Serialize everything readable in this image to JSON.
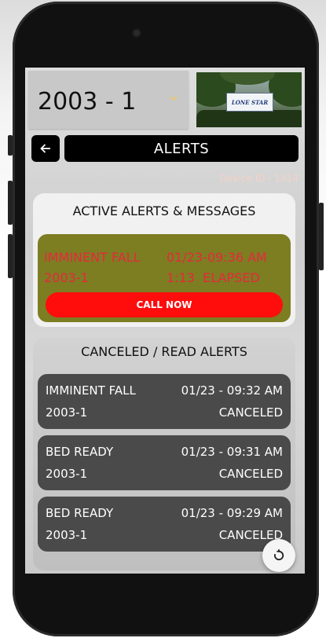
{
  "header": {
    "selected_unit": "2003 - 1",
    "photo_sign_text": "LONE STAR"
  },
  "nav": {
    "title": "ALERTS"
  },
  "device": {
    "label": "Device ID - 1414"
  },
  "active_section": {
    "title": "ACTIVE ALERTS & MESSAGES",
    "alert": {
      "type": "IMMINENT FALL",
      "time": "01/23-09:36 AM",
      "unit": "2003-1",
      "elapsed": "1:13  ELAPSED",
      "action_label": "CALL NOW"
    }
  },
  "canceled_section": {
    "title": "CANCELED / READ ALERTS",
    "items": [
      {
        "type": "IMMINENT FALL",
        "time": "01/23 - 09:32 AM",
        "unit": "2003-1",
        "status": "CANCELED"
      },
      {
        "type": "BED READY",
        "time": "01/23 - 09:31 AM",
        "unit": "2003-1",
        "status": "CANCELED"
      },
      {
        "type": "BED READY",
        "time": "01/23 - 09:29 AM",
        "unit": "2003-1",
        "status": "CANCELED"
      }
    ]
  },
  "colors": {
    "active_alert_bg": "#7d7d22",
    "active_alert_text": "#e7283c",
    "call_button": "#ff0d0d",
    "canceled_row_bg": "#4a4a4a",
    "chevron": "#f0c96a",
    "device_id_text": "#f3d2c8"
  },
  "icons": {
    "back": "arrow-left-icon",
    "select": "chevron-down-icon",
    "refresh": "refresh-icon"
  }
}
